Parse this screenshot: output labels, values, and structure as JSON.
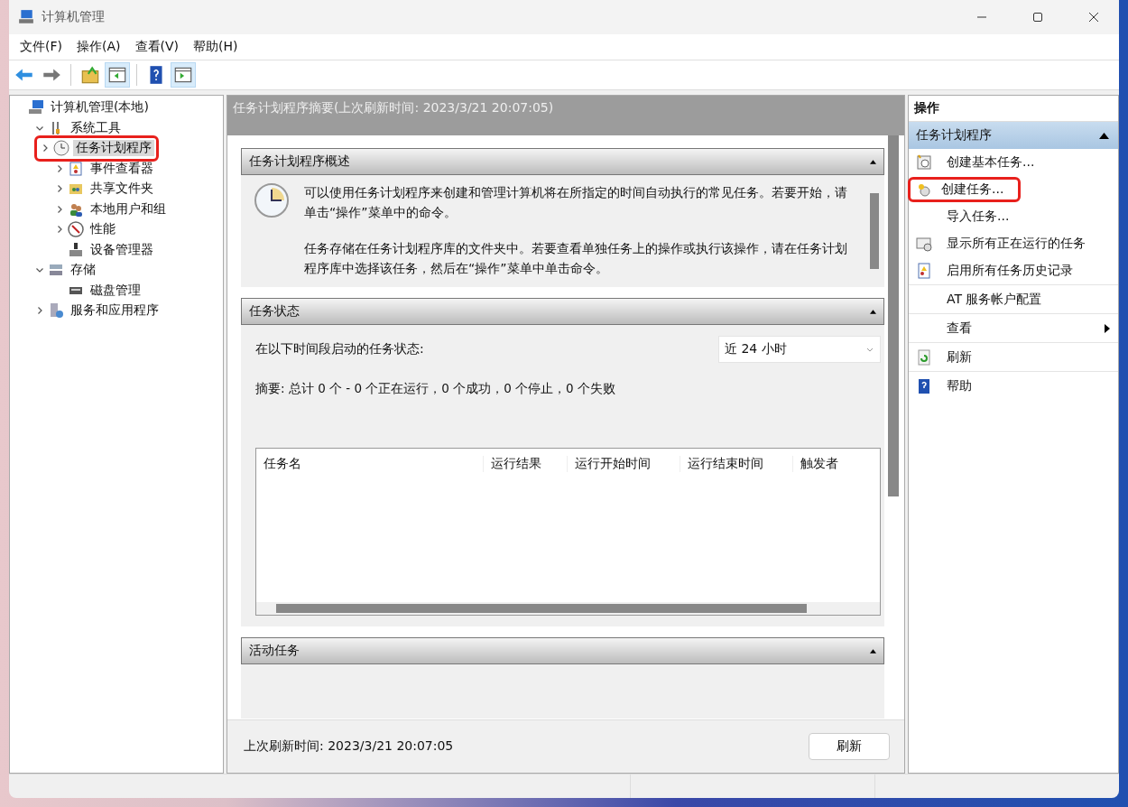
{
  "window": {
    "title": "计算机管理"
  },
  "menu": [
    "文件(F)",
    "操作(A)",
    "查看(V)",
    "帮助(H)"
  ],
  "toolbar": [
    {
      "kind": "back",
      "selected": false
    },
    {
      "kind": "forward",
      "selected": false
    },
    {
      "kind": "up",
      "selected": false
    },
    {
      "kind": "tree",
      "selected": true
    },
    {
      "kind": "help",
      "selected": false
    },
    {
      "kind": "actions",
      "selected": true
    }
  ],
  "tree": [
    {
      "label": "计算机管理(本地)",
      "selected": false,
      "highlighted": false,
      "children": [
        {
          "label": "系统工具",
          "expanded": true,
          "selected": false,
          "highlighted": false,
          "children": [
            {
              "label": "任务计划程序",
              "expanded": false,
              "selected": true,
              "highlighted": true
            },
            {
              "label": "事件查看器",
              "expanded": false,
              "selected": false,
              "highlighted": false
            },
            {
              "label": "共享文件夹",
              "expanded": false,
              "selected": false,
              "highlighted": false
            },
            {
              "label": "本地用户和组",
              "expanded": false,
              "selected": false,
              "highlighted": false
            },
            {
              "label": "性能",
              "expanded": false,
              "selected": false,
              "highlighted": false
            },
            {
              "label": "设备管理器",
              "selected": false,
              "highlighted": false
            }
          ]
        },
        {
          "label": "存储",
          "expanded": true,
          "selected": false,
          "highlighted": false,
          "children": [
            {
              "label": "磁盘管理",
              "selected": false,
              "highlighted": false
            }
          ]
        },
        {
          "label": "服务和应用程序",
          "expanded": false,
          "selected": false,
          "highlighted": false
        }
      ]
    }
  ],
  "center": {
    "title": "任务计划程序摘要(上次刷新时间: 2023/3/21 20:07:05)",
    "overview": {
      "heading": "任务计划程序概述",
      "paragraphs": [
        "可以使用任务计划程序来创建和管理计算机将在所指定的时间自动执行的常见任务。若要开始，请单击“操作”菜单中的命令。",
        "任务存储在任务计划程序库的文件夹中。若要查看单独任务上的操作或执行该操作，请在任务计划程序库中选择该任务，然后在“操作”菜单中单击命令。"
      ]
    },
    "status": {
      "heading": "任务状态",
      "period_label": "在以下时间段启动的任务状态:",
      "period": "近 24 小时",
      "summary": "摘要: 总计 0 个 - 0 个正在运行，0 个成功，0 个停止，0 个失败",
      "columns": [
        "任务名",
        "运行结果",
        "运行开始时间",
        "运行结束时间",
        "触发者"
      ]
    },
    "active": {
      "heading": "活动任务"
    },
    "footer": {
      "refreshed": "上次刷新时间: 2023/3/21 20:07:05",
      "button": "刷新"
    }
  },
  "actions": {
    "title": "操作",
    "group": "任务计划程序",
    "items": [
      {
        "label": "创建基本任务...",
        "kind": "item",
        "highlighted": false
      },
      {
        "label": "创建任务...",
        "kind": "item",
        "highlighted": true
      },
      {
        "label": "导入任务...",
        "kind": "item",
        "highlighted": false
      },
      {
        "label": "显示所有正在运行的任务",
        "kind": "item",
        "highlighted": false
      },
      {
        "label": "启用所有任务历史记录",
        "kind": "item",
        "highlighted": false
      },
      {
        "label": "AT 服务帐户配置",
        "kind": "item",
        "highlighted": false
      },
      {
        "label": "查看",
        "kind": "submenu",
        "highlighted": false
      },
      {
        "label": "刷新",
        "kind": "item",
        "highlighted": false
      },
      {
        "label": "帮助",
        "kind": "item",
        "highlighted": false
      }
    ]
  }
}
